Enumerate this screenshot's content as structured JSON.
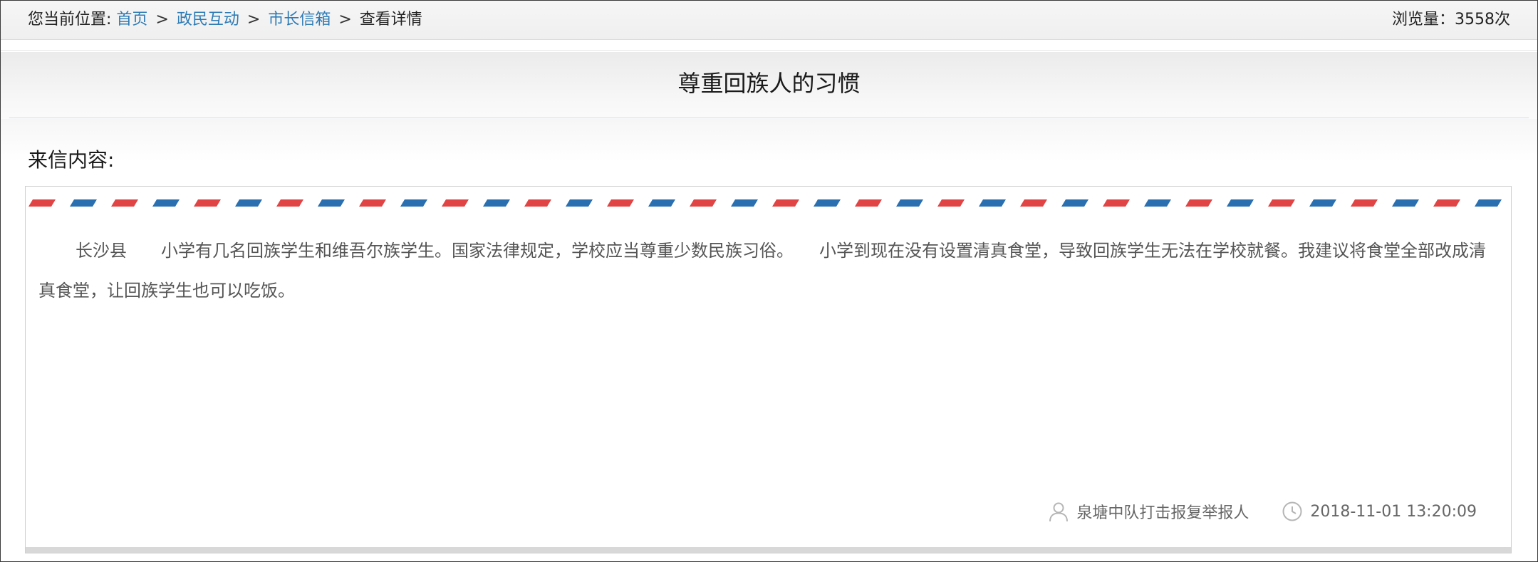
{
  "breadcrumb": {
    "prefix": "您当前位置:",
    "home": "首页",
    "section": "政民互动",
    "subsection": "市长信箱",
    "current": "查看详情",
    "separator": ">"
  },
  "views": {
    "text": "浏览量：3558次"
  },
  "letter": {
    "title": "尊重回族人的习惯",
    "section_label": "来信内容:",
    "body": "长沙县　　小学有几名回族学生和维吾尔族学生。国家法律规定，学校应当尊重少数民族习俗。　　小学到现在没有设置清真食堂，导致回族学生无法在学校就餐。我建议将食堂全部改成清真食堂，让回族学生也可以吃饭。",
    "author": "泉塘中队打击报复举报人",
    "datetime": "2018-11-01 13:20:09"
  },
  "icons": {
    "author": "user-icon",
    "time": "clock-icon"
  },
  "colors": {
    "link": "#2e7bb5",
    "airmail_red": "#e04444",
    "airmail_blue": "#2a6fb0"
  }
}
